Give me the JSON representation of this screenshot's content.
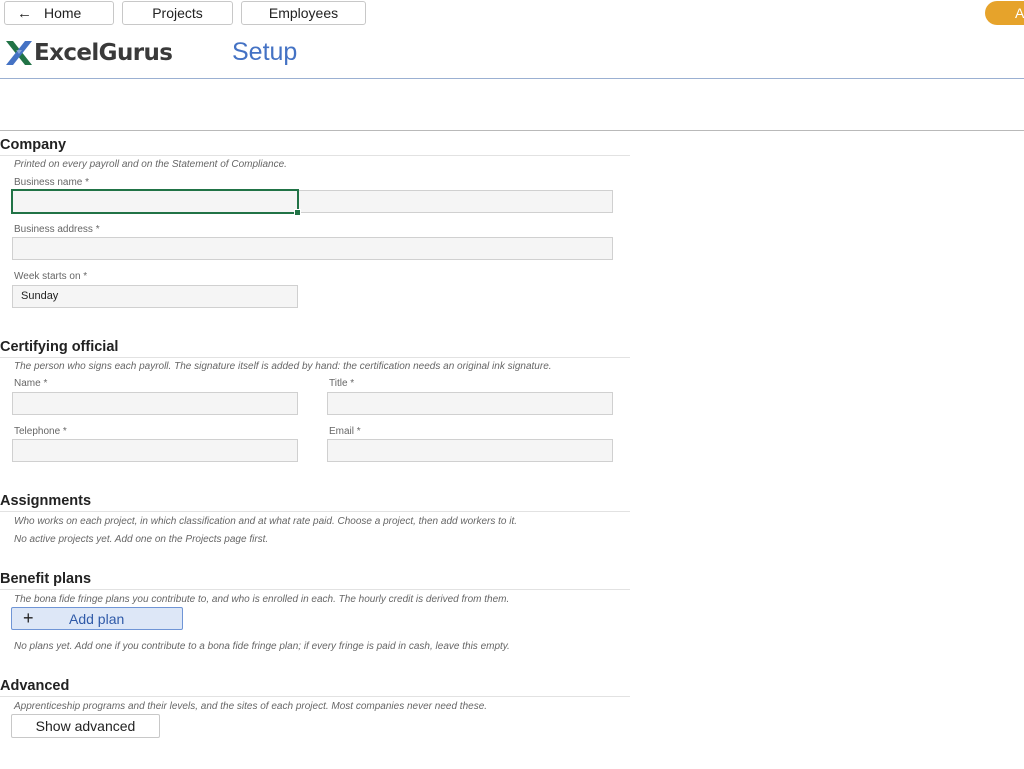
{
  "nav": {
    "home_label": "Home",
    "projects_label": "Projects",
    "employees_label": "Employees",
    "right_pill_label": "A"
  },
  "header": {
    "logo_text": "ExcelGurus",
    "page_title": "Setup"
  },
  "colors": {
    "accent_blue": "#4472c4",
    "selection_green": "#217346",
    "orange": "#e6a32b"
  },
  "company": {
    "title": "Company",
    "description": "Printed on every payroll and on the Statement of Compliance.",
    "business_name_label": "Business name *",
    "business_name_value": "",
    "business_address_label": "Business address *",
    "business_address_value": "",
    "week_starts_label": "Week starts on *",
    "week_starts_value": "Sunday"
  },
  "certifying": {
    "title": "Certifying official",
    "description": "The person who signs each payroll. The signature itself is added by hand: the certification needs an original ink signature.",
    "name_label": "Name *",
    "title_label": "Title *",
    "telephone_label": "Telephone *",
    "email_label": "Email *"
  },
  "assignments": {
    "title": "Assignments",
    "description": "Who works on each project, in which classification and at what rate paid. Choose a project, then add workers to it.",
    "empty_text": "No active projects yet. Add one on the Projects page first."
  },
  "benefits": {
    "title": "Benefit plans",
    "description": "The bona fide fringe plans you contribute to, and who is enrolled in each. The hourly credit is derived from them.",
    "add_label": "Add plan",
    "empty_text": "No plans yet. Add one if you contribute to a bona fide fringe plan; if every fringe is paid in cash, leave this empty."
  },
  "advanced": {
    "title": "Advanced",
    "description": "Apprenticeship programs and their levels, and the sites of each project. Most companies never need these.",
    "button_label": "Show advanced"
  }
}
